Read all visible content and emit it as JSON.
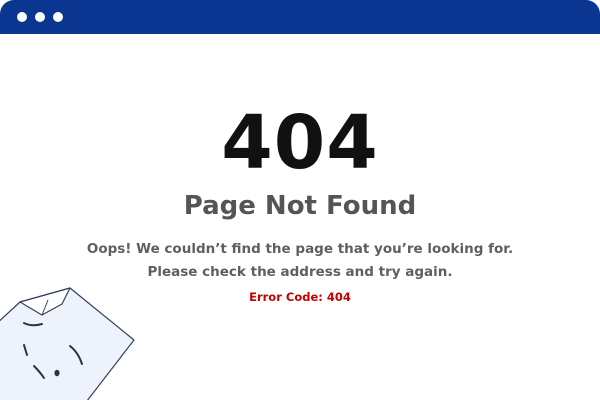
{
  "window": {
    "titlebar_color": "#0a3590",
    "controls": [
      "dot",
      "dot",
      "dot"
    ]
  },
  "error": {
    "code": "404",
    "title": "Page Not Found",
    "message_line1": "Oops! We couldn’t find the page that you’re looking for.",
    "message_line2": "Please check the address and try again.",
    "error_code_label": "Error Code: 404",
    "error_color": "#c40000"
  },
  "illustration": {
    "icon": "sad-page-icon"
  }
}
